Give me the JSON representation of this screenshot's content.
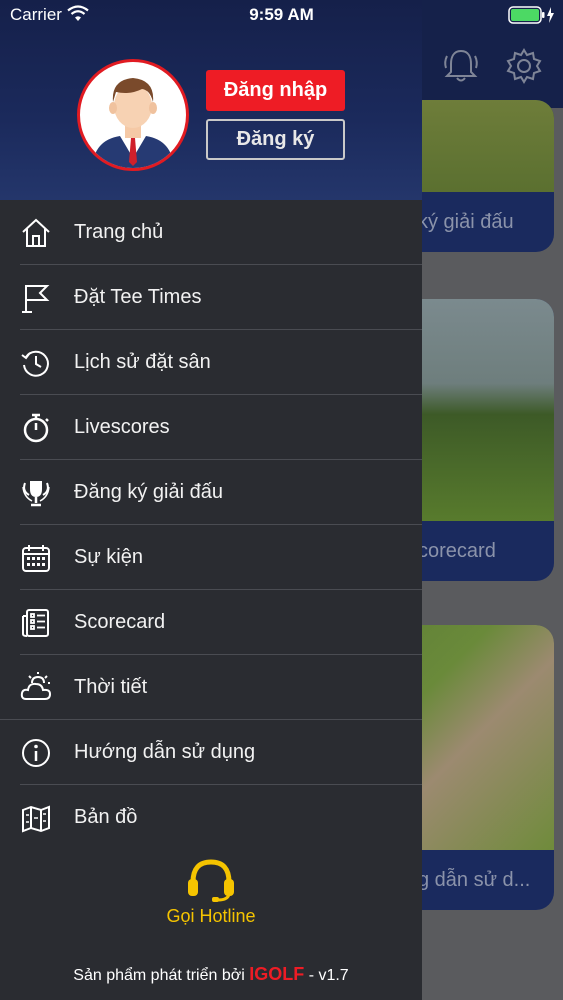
{
  "status_bar": {
    "carrier": "Carrier",
    "time": "9:59 AM"
  },
  "drawer": {
    "login_label": "Đăng nhập",
    "register_label": "Đăng ký",
    "menu": [
      {
        "label": "Trang chủ",
        "icon": "home-icon"
      },
      {
        "label": "Đặt Tee Times",
        "icon": "flag-icon"
      },
      {
        "label": "Lịch sử đặt sân",
        "icon": "history-icon"
      },
      {
        "label": "Livescores",
        "icon": "stopwatch-icon"
      },
      {
        "label": "Đăng ký giải đấu",
        "icon": "trophy-icon"
      },
      {
        "label": "Sự kiện",
        "icon": "calendar-icon"
      },
      {
        "label": "Scorecard",
        "icon": "scorecard-icon"
      },
      {
        "label": "Thời tiết",
        "icon": "weather-icon"
      },
      {
        "label": "Hướng dẫn sử dụng",
        "icon": "info-icon"
      },
      {
        "label": "Bản đồ",
        "icon": "map-icon"
      }
    ],
    "hotline_label": "Gọi Hotline",
    "footer": {
      "prefix": "Sản phẩm phát triển bởi",
      "brand": "IGOLF",
      "suffix": "- v1.7"
    }
  },
  "background": {
    "cards": [
      {
        "caption": "ký giải đấu"
      },
      {
        "caption": "corecard"
      },
      {
        "caption": "g dẫn sử d..."
      }
    ]
  },
  "colors": {
    "accent_red": "#ee1c25",
    "hotline_yellow": "#f5c400",
    "drawer_bg": "#2a2c31",
    "header_navy": "#15214a"
  }
}
